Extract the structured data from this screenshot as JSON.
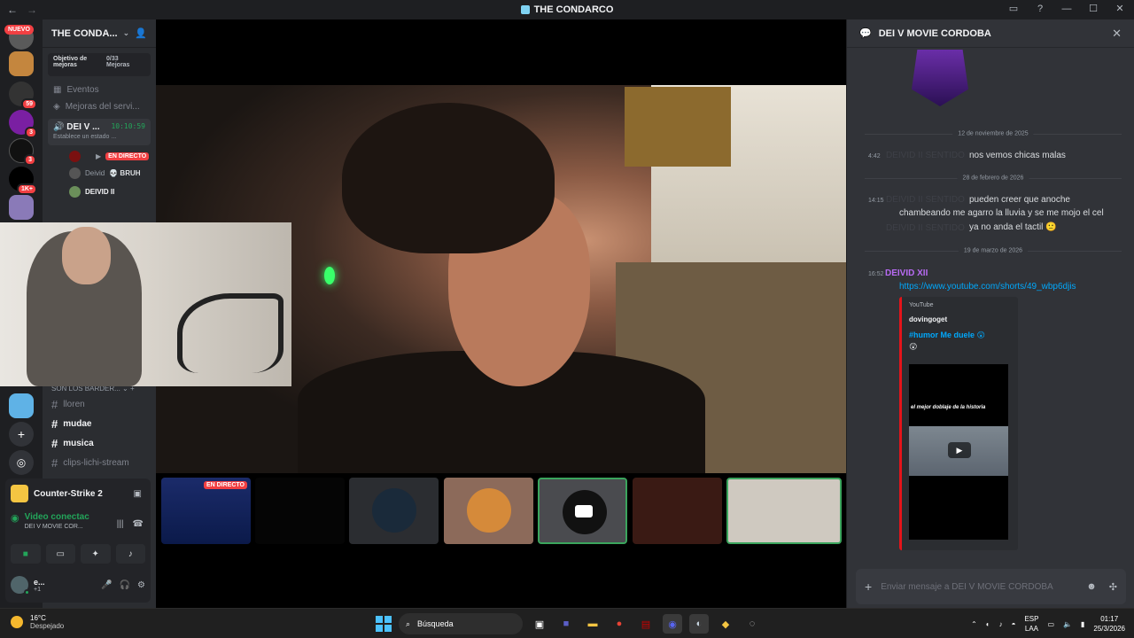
{
  "window": {
    "title": "THE CONDARCO",
    "nav_back": "←",
    "nav_forward": "→",
    "controls": [
      "▭",
      "?",
      "—",
      "☐",
      "✕"
    ]
  },
  "rail": {
    "new_label": "NUEVO",
    "badges": [
      "59",
      "3",
      "3",
      "1K+"
    ]
  },
  "server": {
    "name": "THE CONDA...",
    "boost_label": "Objetivo de mejoras",
    "boost_count": "0/33",
    "boost_unit": "Mejoras",
    "links": [
      {
        "label": "Eventos"
      },
      {
        "label": "Mejoras del servi..."
      }
    ],
    "voice_channel": {
      "name": "DEI V ...",
      "timer": "10:10:59",
      "status": "Establece un estado ..."
    },
    "voice_users": [
      {
        "name": "",
        "tag": "EN DIRECTO"
      },
      {
        "name": "Deivid",
        "tag": "💀 BRUH"
      },
      {
        "name": "DEIVID II",
        "tag": ""
      }
    ],
    "category": "SON LOS BARDER...",
    "channels": [
      {
        "label": "lloren",
        "unread": false
      },
      {
        "label": "mudae",
        "unread": true
      },
      {
        "label": "musica",
        "unread": true
      },
      {
        "label": "clips-lichi-stream",
        "unread": false
      }
    ]
  },
  "activity": {
    "game": "Counter-Strike 2",
    "voice_status": "Video conectac",
    "voice_channel": "DEI V MOVIE COR...",
    "user_name": "e...",
    "user_sub": "+1"
  },
  "stage": {
    "thumbs": [
      {
        "live_label": "EN DIRECTO"
      }
    ]
  },
  "chat": {
    "title": "DEI V MOVIE CORDOBA",
    "date1": "12 de noviembre de 2025",
    "msg1": {
      "time": "4:42",
      "ghost": "DEIVID II SENTIDO",
      "text": "nos vemos chicas malas"
    },
    "date2": "28 de febrero de 2026",
    "msg2": {
      "time": "14:15",
      "ghost": "DEIVID II SENTIDO",
      "line1": "pueden creer que anoche",
      "line2": "chambeando me agarro la lluvia y se me mojo el cel",
      "line3": "ya no anda el tactil 🙁",
      "ghost2": "DEIVID II SENTIDO"
    },
    "date3": "19 de marzo de 2026",
    "msg3": {
      "time": "16:52",
      "author": "DEIVID XII",
      "link": "https://www.youtube.com/shorts/49_wbp6djis"
    },
    "embed": {
      "provider": "YouTube",
      "channel": "dovingoget",
      "title": "#humor Me duele 😲",
      "title2": "😲",
      "caption": "el mejor doblaje de la historia"
    },
    "placeholder": "Enviar mensaje a DEI V MOVIE CORDOBA",
    "accent": "#e4141a"
  },
  "taskbar": {
    "temp": "16°C",
    "weather": "Despejado",
    "search": "Búsqueda",
    "lang1": "ESP",
    "lang2": "LAA",
    "time": "01:17",
    "date": "25/3/2026"
  }
}
